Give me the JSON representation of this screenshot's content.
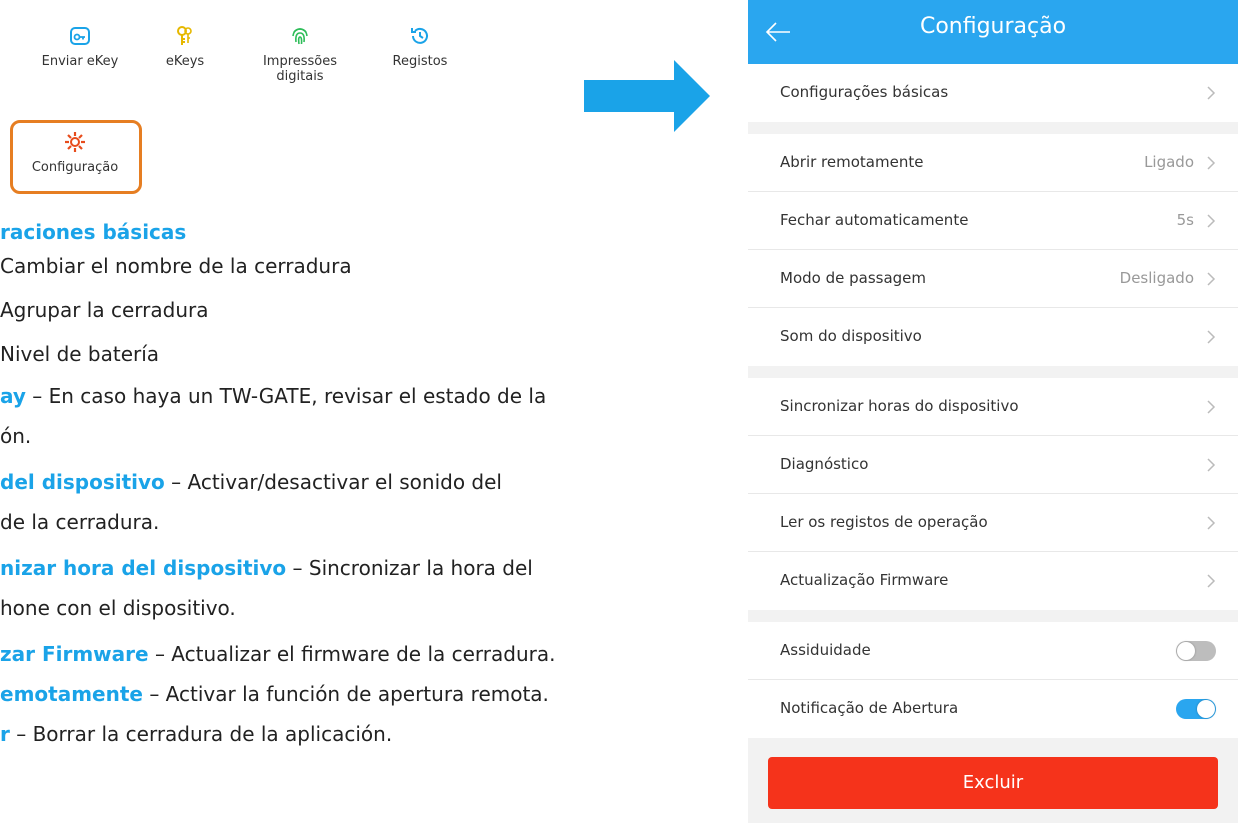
{
  "app_menu": {
    "items": [
      {
        "label": "Enviar eKey",
        "icon": "send-ekey-icon"
      },
      {
        "label": "eKeys",
        "icon": "key-icon"
      },
      {
        "label": "Impressões\ndigitais",
        "icon": "fingerprint-icon"
      },
      {
        "label": "Registos",
        "icon": "history-icon"
      }
    ],
    "settings": {
      "label": "Configuração",
      "icon": "gear-icon"
    },
    "highlight_color": "#e67e22"
  },
  "doc": {
    "l1": "raciones básicas",
    "l2": "Cambiar el nombre de la cerradura",
    "l3": "Agrupar la cerradura",
    "l4": "Nivel de batería",
    "l5_hl": "ay",
    "l5_rest": " – En caso haya un TW-GATE, revisar el estado de la",
    "l6": "ón.",
    "l7_hl": " del dispositivo",
    "l7_rest": " – Activar/desactivar el sonido del",
    "l8": " de la cerradura.",
    "l9_hl": "nizar hora del dispositivo",
    "l9_rest": " – Sincronizar la hora del",
    "l10": "hone con el dispositivo.",
    "l11_hl": "zar Firmware",
    "l11_rest": " – Actualizar el firmware de la cerradura.",
    "l12_hl": "emotamente",
    "l12_rest": " – Activar la función de apertura remota.",
    "l13_hl": "r",
    "l13_rest": " – Borrar la cerradura de la aplicación.",
    "highlight_color": "#1aa3e8"
  },
  "phone": {
    "title": "Configuração",
    "accent_color": "#2aa6ef",
    "rows": {
      "basic": {
        "label": "Configurações básicas"
      },
      "remote": {
        "label": "Abrir remotamente",
        "value": "Ligado"
      },
      "autoclose": {
        "label": "Fechar automaticamente",
        "value": "5s"
      },
      "passage": {
        "label": "Modo de passagem",
        "value": "Desligado"
      },
      "sound": {
        "label": "Som do dispositivo"
      },
      "sync": {
        "label": "Sincronizar horas do dispositivo"
      },
      "diag": {
        "label": "Diagnóstico"
      },
      "logs": {
        "label": "Ler os registos de operação"
      },
      "firmware": {
        "label": "Actualização Firmware"
      },
      "attendance": {
        "label": "Assiduidade",
        "on": false
      },
      "notif": {
        "label": "Notificação de Abertura",
        "on": true
      }
    },
    "delete_label": "Excluir",
    "delete_color": "#f5331b"
  }
}
